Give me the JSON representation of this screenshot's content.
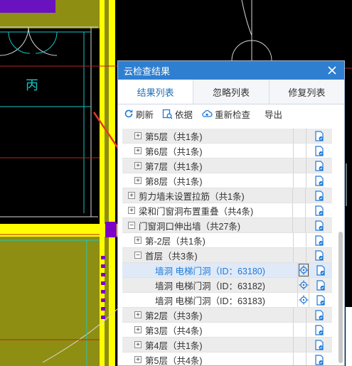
{
  "drawing": {
    "room_label": "丙"
  },
  "panel": {
    "title": "云检查结果",
    "tabs": [
      "结果列表",
      "忽略列表",
      "修复列表"
    ],
    "toolbar": {
      "refresh": "刷新",
      "basis": "依据",
      "recheck": "重新检查",
      "export": "导出"
    },
    "rows": [
      {
        "text": "第5层（共1条)",
        "level": 1,
        "toggle": "+"
      },
      {
        "text": "第6层（共1条)",
        "level": 1,
        "toggle": "+"
      },
      {
        "text": "第7层（共1条)",
        "level": 1,
        "toggle": "+"
      },
      {
        "text": "第8层（共1条)",
        "level": 1,
        "toggle": "+"
      },
      {
        "text": "剪力墙未设置拉筋（共1条)",
        "level": 0,
        "toggle": "+"
      },
      {
        "text": "梁和门窗洞布置重叠（共4条)",
        "level": 0,
        "toggle": "+"
      },
      {
        "text": "门窗洞口伸出墙（共27条)",
        "level": 0,
        "toggle": "−"
      },
      {
        "text": "第-2层（共1条)",
        "level": 1,
        "toggle": "+"
      },
      {
        "text": "首层（共3条)",
        "level": 1,
        "toggle": "−"
      },
      {
        "text": "墙洞 电梯门洞（ID：63180)",
        "level": 2,
        "toggle": "",
        "locate": true,
        "blue": true
      },
      {
        "text": "墙洞 电梯门洞（ID：63182)",
        "level": 2,
        "toggle": "",
        "locate": true
      },
      {
        "text": "墙洞 电梯门洞（ID：63183)",
        "level": 2,
        "toggle": "",
        "locate": true
      },
      {
        "text": "第2层（共3条)",
        "level": 1,
        "toggle": "+"
      },
      {
        "text": "第3层（共4条)",
        "level": 1,
        "toggle": "+"
      },
      {
        "text": "第4层（共1条)",
        "level": 1,
        "toggle": "+"
      },
      {
        "text": "第5层（共4条)",
        "level": 1,
        "toggle": "+"
      }
    ]
  },
  "colors": {
    "accent": "#2f7fd0",
    "cad_yellow": "#ffff00",
    "cad_purple": "#7b00c8",
    "arrow": "#e23a2a"
  }
}
